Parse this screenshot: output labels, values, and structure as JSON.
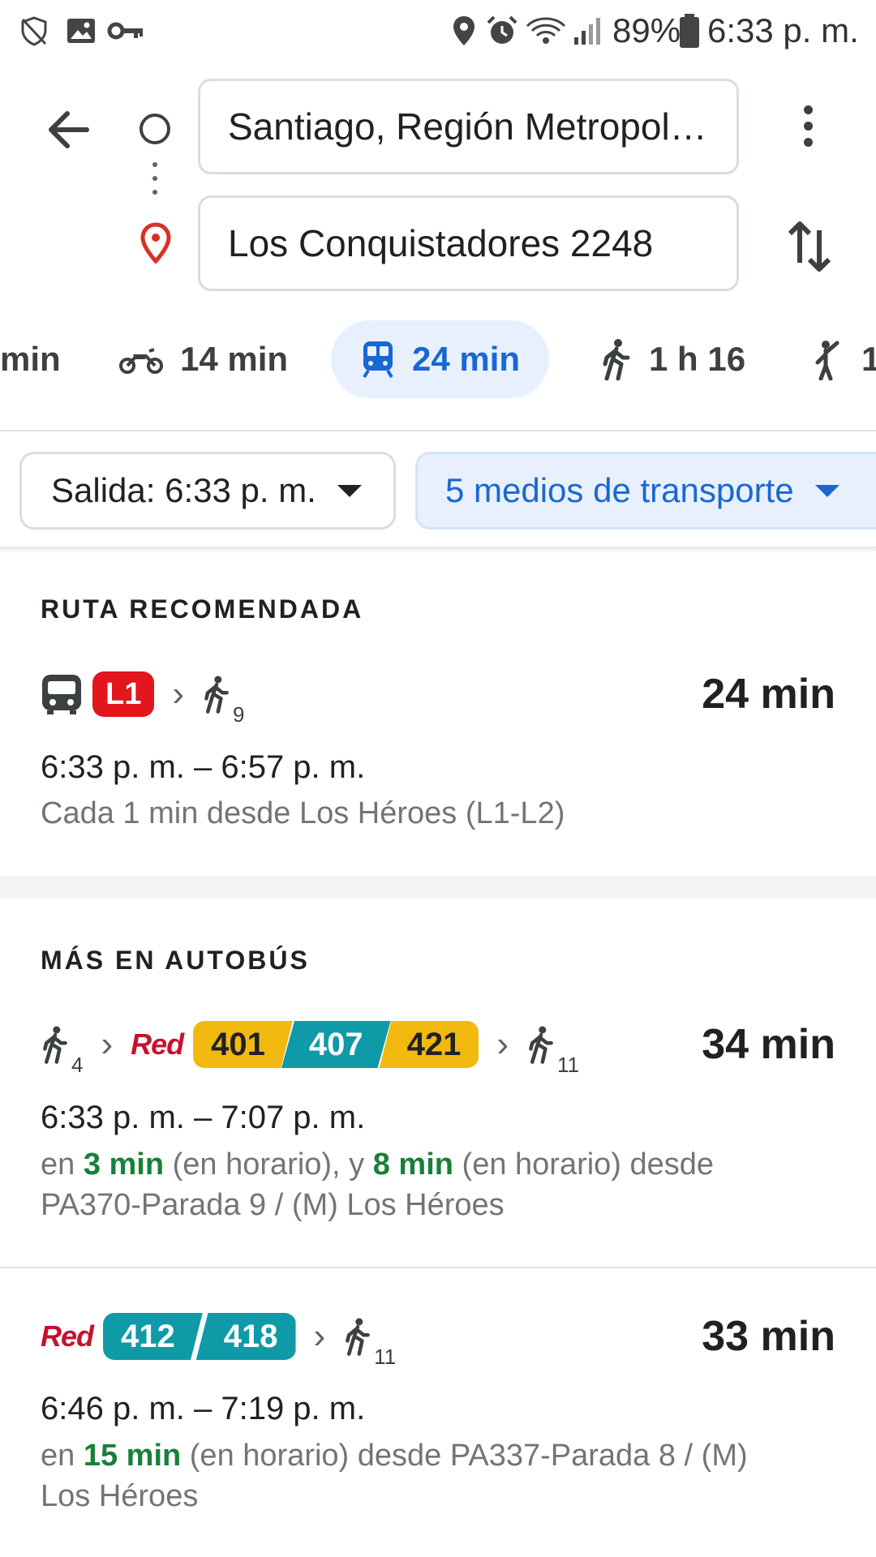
{
  "status_bar": {
    "battery": "89%",
    "time": "6:33 p. m."
  },
  "search": {
    "origin": "Santiago, Región Metropol…",
    "destination": "Los Conquistadores 2248"
  },
  "modes": {
    "partial": "min",
    "motorcycle": "14 min",
    "transit": "24 min",
    "walking": "1 h 16",
    "ride": "1"
  },
  "filters": {
    "departure": "Salida: 6:33 p. m.",
    "transport_modes": "5 medios de transporte"
  },
  "recommended": {
    "section_title": "RUTA RECOMENDADA",
    "line_badge": "L1",
    "walk_minutes": "9",
    "duration": "24 min",
    "times": "6:33 p. m. – 6:57 p. m.",
    "detail": "Cada 1 min desde Los Héroes (L1-L2)"
  },
  "bus_section": {
    "section_title": "MÁS EN AUTOBÚS",
    "routes": [
      {
        "walk_before": "4",
        "operator": "Red",
        "lines": [
          "401",
          "407",
          "421"
        ],
        "walk_after": "11",
        "duration": "34 min",
        "times": "6:33 p. m. – 7:07 p. m.",
        "detail_prefix": "en ",
        "eta_1": "3 min",
        "detail_mid": " (en horario), y ",
        "eta_2": "8 min",
        "detail_suffix": " (en horario) desde PA370-Parada 9 / (M) Los Héroes"
      },
      {
        "operator": "Red",
        "lines": [
          "412",
          "418"
        ],
        "walk_after": "11",
        "duration": "33 min",
        "times": "6:46 p. m. – 7:19 p. m.",
        "detail_prefix": "en ",
        "eta_1": "15 min",
        "detail_suffix": " (en horario) desde PA337-Parada 8 / (M) Los Héroes"
      }
    ]
  },
  "colors": {
    "accent_blue": "#1967d2",
    "metro_red": "#e3151d",
    "bus_yellow": "#f2b90f",
    "bus_teal": "#0f9aa8",
    "on_time_green": "#188038"
  }
}
